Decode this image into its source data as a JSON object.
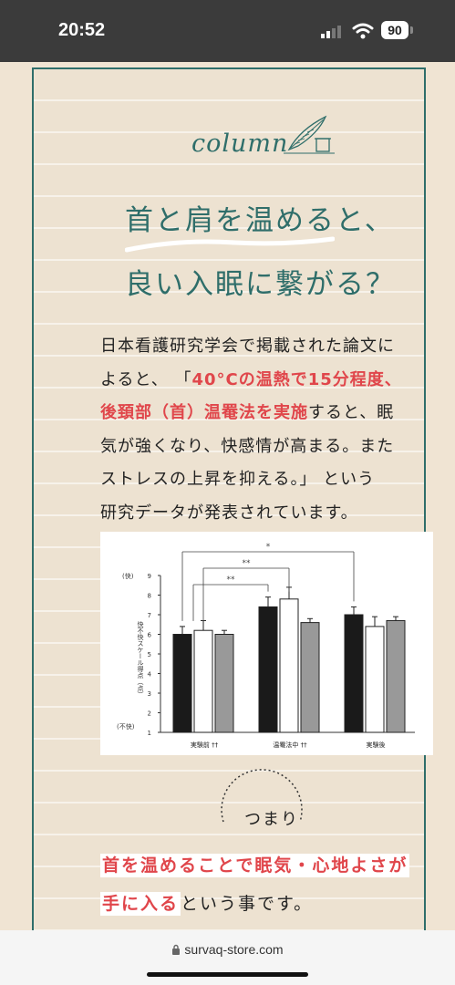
{
  "status": {
    "time": "20:52",
    "battery": "90"
  },
  "column": {
    "label": "column"
  },
  "headline": {
    "line1": "首と肩を温めると、",
    "line2": "良い入眠に繋がる？"
  },
  "body": {
    "l1": "日本看護研究学会で掲載された論文に",
    "l2a": "よると、 「",
    "l2b": "40°Cの温熱で15分程度、",
    "l3a": "後頚部（首）温罨法を実施",
    "l3b": "すると、眠",
    "l4": "気が強くなり、快感情が高まる。また",
    "l5": "ストレスの上昇を抑える。」 という",
    "l6": "研究データが発表されています。"
  },
  "chart_data": {
    "type": "bar",
    "categories": [
      "実験前",
      "温罨法中",
      "実験後"
    ],
    "category_marks": [
      "††",
      "††",
      ""
    ],
    "series": [
      {
        "values": [
          6.0,
          7.4,
          7.0
        ],
        "color": "#1a1a1a"
      },
      {
        "values": [
          6.2,
          7.8,
          6.4
        ],
        "color": "#ffffff"
      },
      {
        "values": [
          6.0,
          6.6,
          6.7
        ],
        "color": "#999999"
      }
    ],
    "errors": [
      [
        0.4,
        0.5,
        0.4
      ],
      [
        0.5,
        0.6,
        0.5
      ],
      [
        0.2,
        0.2,
        0.2
      ]
    ],
    "ylabel": "快不快スケール得点（点）",
    "ytop_label": "(快)",
    "ybottom_label": "(不快)",
    "ylim": [
      1,
      9
    ],
    "yticks": [
      1,
      2,
      3,
      4,
      5,
      6,
      7,
      8,
      9
    ],
    "significance": [
      "*",
      "**",
      "**"
    ]
  },
  "summary": {
    "tsumari": "つまり",
    "line1": "首を温めることで眠気・心地よさが",
    "line2_mark": "手に入る",
    "line2_rest": "という事です。"
  },
  "browser": {
    "url": "survaq-store.com"
  }
}
